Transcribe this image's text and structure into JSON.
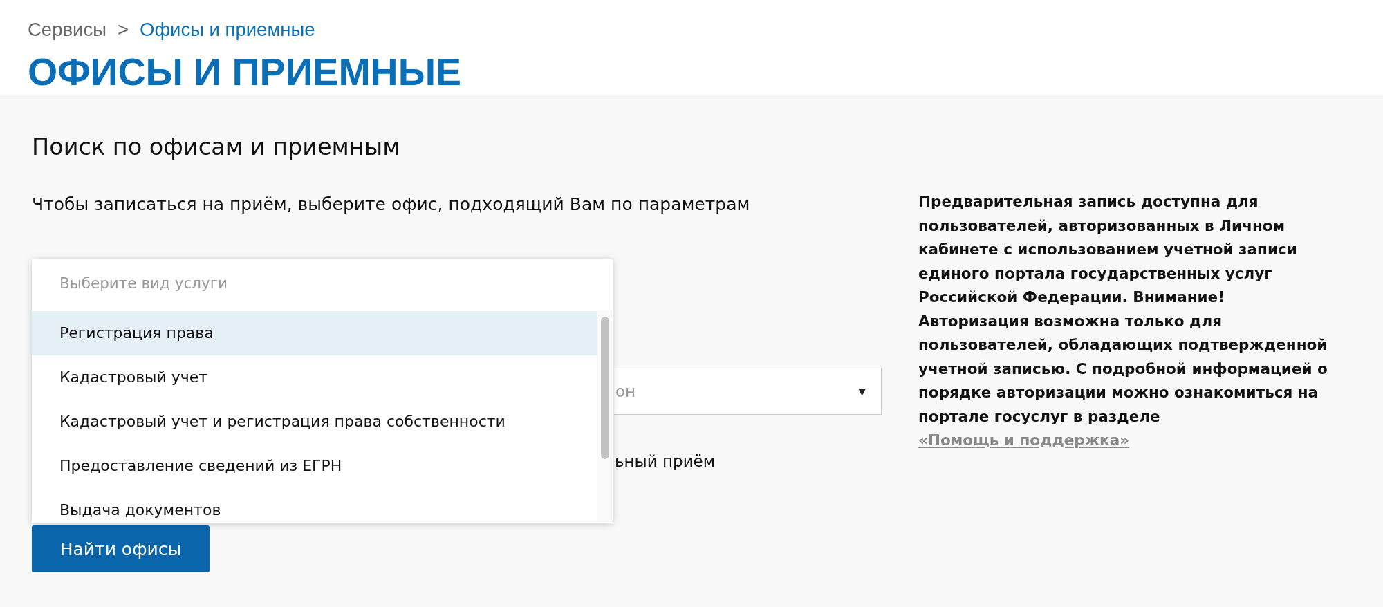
{
  "breadcrumb": [
    {
      "label": "Сервисы",
      "current": false
    },
    {
      "label": "Офисы и приемные",
      "current": true
    }
  ],
  "breadcrumb_separator": ">",
  "title": "ОФИСЫ И ПРИЕМНЫЕ",
  "search": {
    "heading": "Поиск по офисам и приемным",
    "description": "Чтобы записаться на приём, выберите офис, подходящий Вам по параметрам",
    "service_dropdown": {
      "placeholder": "Выберите вид услуги",
      "options": [
        {
          "label": "Регистрация права",
          "selected": true
        },
        {
          "label": "Кадастровый учет",
          "selected": false
        },
        {
          "label": "Кадастровый учет и регистрация права собственности",
          "selected": false
        },
        {
          "label": "Предоставление сведений из ЕГРН",
          "selected": false
        },
        {
          "label": "Выдача документов",
          "selected": false
        }
      ]
    },
    "region_field": {
      "placeholder": "он",
      "arrow": "▼"
    },
    "appointment_option": "ьный приём",
    "submit_button": "Найти офисы"
  },
  "info_note": {
    "text": "Предварительная запись доступна для пользователей, авторизованных в Личном кабинете с использованием учетной записи единого портала государственных услуг Российской Федерации. Внимание! Авторизация возможна только для пользователей, обладающих подтвержденной учетной записью. С подробной информацией о порядке авторизации можно ознакомиться на портале госуслуг в разделе ",
    "link": "«Помощь и поддержка»"
  }
}
